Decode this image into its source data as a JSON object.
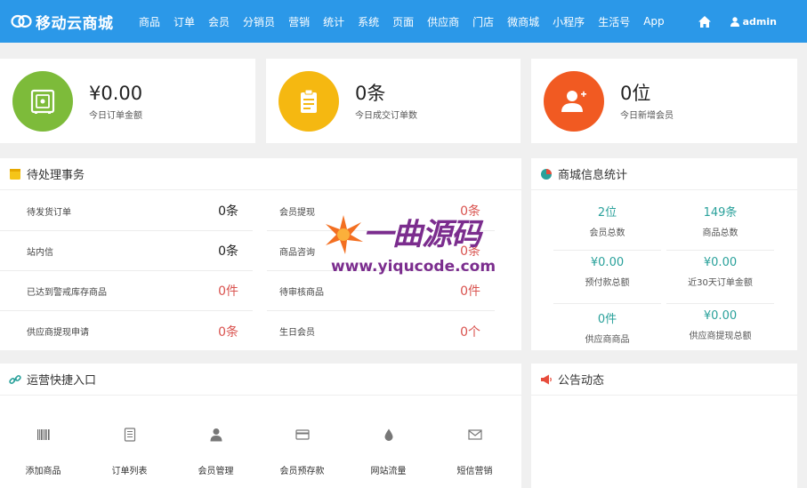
{
  "header": {
    "brand": "移动云商城",
    "nav": [
      "商品",
      "订单",
      "会员",
      "分销员",
      "营销",
      "统计",
      "系统",
      "页面",
      "供应商",
      "门店",
      "微商城",
      "小程序",
      "生活号",
      "App"
    ],
    "user": "admin"
  },
  "stats": [
    {
      "value": "¥0.00",
      "label": "今日订单金额",
      "icon": "safe-icon",
      "color": "#7dbb3a"
    },
    {
      "value": "0条",
      "label": "今日成交订单数",
      "icon": "clipboard-icon",
      "color": "#f5b811"
    },
    {
      "value": "0位",
      "label": "今日新增会员",
      "icon": "user-add-icon",
      "color": "#f15a22"
    }
  ],
  "pending": {
    "title": "待处理事务",
    "rows": [
      [
        {
          "label": "待发货订单",
          "value": "0条",
          "red": false
        },
        {
          "label": "会员提现",
          "value": "0条",
          "red": true
        }
      ],
      [
        {
          "label": "站内信",
          "value": "0条",
          "red": false
        },
        {
          "label": "商品咨询",
          "value": "0条",
          "red": true
        }
      ],
      [
        {
          "label": "已达到警戒库存商品",
          "value": "0件",
          "red": true
        },
        {
          "label": "待审核商品",
          "value": "0件",
          "red": true
        }
      ],
      [
        {
          "label": "供应商提现申请",
          "value": "0条",
          "red": true
        },
        {
          "label": "生日会员",
          "value": "0个",
          "red": true
        }
      ]
    ]
  },
  "mall": {
    "title": "商城信息统计",
    "rows": [
      [
        {
          "value": "2位",
          "label": "会员总数"
        },
        {
          "value": "149条",
          "label": "商品总数"
        }
      ],
      [
        {
          "value": "¥0.00",
          "label": "预付款总额"
        },
        {
          "value": "¥0.00",
          "label": "近30天订单金额"
        }
      ],
      [
        {
          "value": "0件",
          "label": "供应商商品"
        },
        {
          "value": "¥0.00",
          "label": "供应商提现总额"
        }
      ]
    ]
  },
  "quick": {
    "title": "运营快捷入口",
    "items": [
      {
        "label": "添加商品",
        "icon": "barcode-icon"
      },
      {
        "label": "订单列表",
        "icon": "list-icon"
      },
      {
        "label": "会员管理",
        "icon": "user-icon"
      },
      {
        "label": "会员预存款",
        "icon": "card-icon"
      },
      {
        "label": "网站流量",
        "icon": "drop-icon"
      },
      {
        "label": "短信营销",
        "icon": "mail-icon"
      }
    ]
  },
  "notice": {
    "title": "公告动态"
  },
  "watermark": {
    "title": "一曲源码",
    "url": "www.yiqucode.com"
  }
}
